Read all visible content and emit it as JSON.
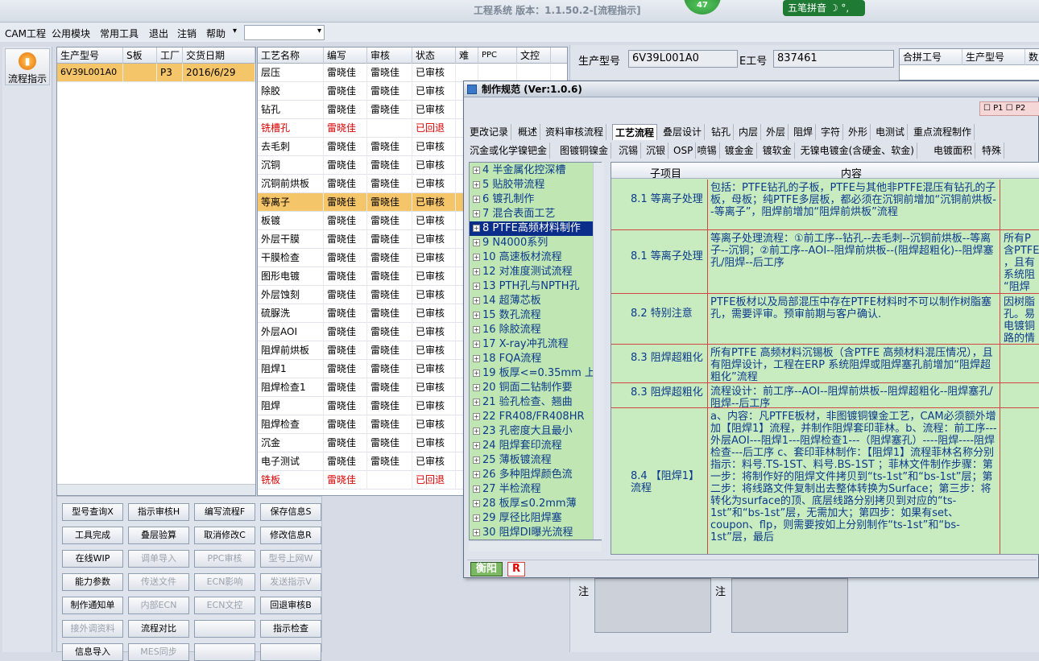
{
  "window": {
    "title": "工程系统 版本：1.1.50.2-[流程指示]",
    "badge": "47",
    "ime_label": "五笔拼音 ☽ °,"
  },
  "menu": {
    "items": [
      "CAM工程",
      "公用模块",
      "常用工具",
      "退出",
      "注销",
      "帮助"
    ],
    "combo_value": ""
  },
  "nav": {
    "label": "流程指示",
    "icon": "play-circle-icon"
  },
  "order_grid": {
    "headers": [
      "生产型号",
      "S板",
      "工厂",
      "交货日期"
    ],
    "rows": [
      [
        "6V39L001A0",
        "",
        "P3",
        "2016/6/29"
      ]
    ]
  },
  "process_grid": {
    "headers": [
      "工艺名称",
      "编写",
      "审核",
      "状态",
      "难",
      "PPC",
      "文控"
    ],
    "rows": [
      {
        "name": "层压",
        "writer": "雷晓佳",
        "reviewer": "雷晓佳",
        "status": "已审核",
        "red": false,
        "selected": false
      },
      {
        "name": "除胶",
        "writer": "雷晓佳",
        "reviewer": "雷晓佳",
        "status": "已审核",
        "red": false,
        "selected": false
      },
      {
        "name": "钻孔",
        "writer": "雷晓佳",
        "reviewer": "雷晓佳",
        "status": "已审核",
        "red": false,
        "selected": false
      },
      {
        "name": "铣槽孔",
        "writer": "雷晓佳",
        "reviewer": "",
        "status": "已回退",
        "red": true,
        "selected": false
      },
      {
        "name": "去毛刺",
        "writer": "雷晓佳",
        "reviewer": "雷晓佳",
        "status": "已审核",
        "red": false,
        "selected": false
      },
      {
        "name": "沉铜",
        "writer": "雷晓佳",
        "reviewer": "雷晓佳",
        "status": "已审核",
        "red": false,
        "selected": false
      },
      {
        "name": "沉铜前烘板",
        "writer": "雷晓佳",
        "reviewer": "雷晓佳",
        "status": "已审核",
        "red": false,
        "selected": false
      },
      {
        "name": "等离子",
        "writer": "雷晓佳",
        "reviewer": "雷晓佳",
        "status": "已审核",
        "red": false,
        "selected": true
      },
      {
        "name": "板镀",
        "writer": "雷晓佳",
        "reviewer": "雷晓佳",
        "status": "已审核",
        "red": false,
        "selected": false
      },
      {
        "name": "外层干膜",
        "writer": "雷晓佳",
        "reviewer": "雷晓佳",
        "status": "已审核",
        "red": false,
        "selected": false
      },
      {
        "name": "干膜检查",
        "writer": "雷晓佳",
        "reviewer": "雷晓佳",
        "status": "已审核",
        "red": false,
        "selected": false
      },
      {
        "name": "图形电镀",
        "writer": "雷晓佳",
        "reviewer": "雷晓佳",
        "status": "已审核",
        "red": false,
        "selected": false
      },
      {
        "name": "外层蚀刻",
        "writer": "雷晓佳",
        "reviewer": "雷晓佳",
        "status": "已审核",
        "red": false,
        "selected": false
      },
      {
        "name": "硫脲洗",
        "writer": "雷晓佳",
        "reviewer": "雷晓佳",
        "status": "已审核",
        "red": false,
        "selected": false
      },
      {
        "name": "外层AOI",
        "writer": "雷晓佳",
        "reviewer": "雷晓佳",
        "status": "已审核",
        "red": false,
        "selected": false
      },
      {
        "name": "阻焊前烘板",
        "writer": "雷晓佳",
        "reviewer": "雷晓佳",
        "status": "已审核",
        "red": false,
        "selected": false
      },
      {
        "name": "阻焊1",
        "writer": "雷晓佳",
        "reviewer": "雷晓佳",
        "status": "已审核",
        "red": false,
        "selected": false
      },
      {
        "name": "阻焊检查1",
        "writer": "雷晓佳",
        "reviewer": "雷晓佳",
        "status": "已审核",
        "red": false,
        "selected": false
      },
      {
        "name": "阻焊",
        "writer": "雷晓佳",
        "reviewer": "雷晓佳",
        "status": "已审核",
        "red": false,
        "selected": false
      },
      {
        "name": "阻焊检查",
        "writer": "雷晓佳",
        "reviewer": "雷晓佳",
        "status": "已审核",
        "red": false,
        "selected": false
      },
      {
        "name": "沉金",
        "writer": "雷晓佳",
        "reviewer": "雷晓佳",
        "status": "已审核",
        "red": false,
        "selected": false
      },
      {
        "name": "电子测试",
        "writer": "雷晓佳",
        "reviewer": "雷晓佳",
        "status": "已审核",
        "red": false,
        "selected": false
      },
      {
        "name": "铣板",
        "writer": "雷晓佳",
        "reviewer": "",
        "status": "已回退",
        "red": true,
        "selected": false
      }
    ]
  },
  "buttons": [
    {
      "label": "型号查询X",
      "enabled": true
    },
    {
      "label": "指示审核H",
      "enabled": true
    },
    {
      "label": "编写流程F",
      "enabled": true
    },
    {
      "label": "保存信息S",
      "enabled": true
    },
    {
      "label": "工具完成",
      "enabled": true
    },
    {
      "label": "叠层验算",
      "enabled": true
    },
    {
      "label": "取消修改C",
      "enabled": true
    },
    {
      "label": "修改信息R",
      "enabled": true
    },
    {
      "label": "在线WIP",
      "enabled": true
    },
    {
      "label": "调单导入",
      "enabled": false
    },
    {
      "label": "PPC审核",
      "enabled": false
    },
    {
      "label": "型号上网W",
      "enabled": false
    },
    {
      "label": "能力参数",
      "enabled": true
    },
    {
      "label": "传送文件",
      "enabled": false
    },
    {
      "label": "ECN影响",
      "enabled": false
    },
    {
      "label": "发送指示V",
      "enabled": false
    },
    {
      "label": "制作通知单",
      "enabled": true
    },
    {
      "label": "内部ECN",
      "enabled": false
    },
    {
      "label": "ECN文控",
      "enabled": false
    },
    {
      "label": "回退审核B",
      "enabled": true
    },
    {
      "label": "接外调资料",
      "enabled": false
    },
    {
      "label": "流程对比",
      "enabled": true
    },
    {
      "label": "",
      "enabled": true
    },
    {
      "label": "指示检查",
      "enabled": true
    },
    {
      "label": "信息导入",
      "enabled": true
    },
    {
      "label": "MES同步",
      "enabled": false
    },
    {
      "label": "",
      "enabled": true
    },
    {
      "label": "",
      "enabled": true
    }
  ],
  "right_panel": {
    "model_label": "生产型号",
    "model_value": "6V39L001A0",
    "e_label": "E工号",
    "e_value": "837461",
    "merge_headers": [
      "合拼工号",
      "生产型号",
      "数"
    ],
    "note_label": "注"
  },
  "dialog": {
    "title": "制作规范 (Ver:1.0.6)",
    "checks": [
      "P1",
      "P2"
    ],
    "tabs_row1": [
      "更改记录",
      "概述",
      "资料审核流程",
      "工艺流程",
      "叠层设计",
      "钻孔",
      "内层",
      "外层",
      "阻焊",
      "字符",
      "外形",
      "电测试",
      "重点流程制作"
    ],
    "active_tab": "工艺流程",
    "tabs_row2": [
      "沉金或化学镍钯金",
      "图镀铜镍金",
      "沉锡",
      "沉银",
      "OSP",
      "喷锡",
      "镀金金",
      "镀软金",
      "无镍电镀金(含硬金、软金)",
      "电镀面积",
      "特殊"
    ],
    "tree_items": [
      "4 半金属化控深槽",
      "5 贴胶带流程",
      "6 镀孔制作",
      "7 混合表面工艺",
      "8 PTFE高频材料制作",
      "9 N4000系列",
      "10 高速板材流程",
      "12 对准度测试流程",
      "13 PTH孔与NPTH孔",
      "14 超薄芯板",
      "15 数孔流程",
      "16 除胶流程",
      "17 X-ray冲孔流程",
      "18 FQA流程",
      "19 板厚<=0.35mm 上",
      "20 铜面二钻制作要",
      "21 验孔检查、翘曲",
      "22 FR408/FR408HR",
      "23 孔密度大且最小",
      "24 阻焊套印流程",
      "25 薄板镀流程",
      "26 多种阻焊颜色流",
      "27 半检流程",
      "28 板厚≤0.2mm薄",
      "29 厚径比阻焊塞",
      "30 阻焊DI曝光流程"
    ],
    "tree_selected": 4,
    "detail_headers": [
      "子项目",
      "内容"
    ],
    "detail_rows": [
      {
        "sub": "8.1 等离子处理",
        "content": "包括：PTFE钻孔的子板，PTFE与其他非PTFE混压有钻孔的子板，母板；纯PTFE多层板，都必须在沉铜前增加“沉铜前烘板--等离子”，阻焊前增加“阻焊前烘板”流程",
        "extra": ""
      },
      {
        "sub": "8.1 等离子处理",
        "content": "等离子处理流程：①前工序--钻孔--去毛刺--沉铜前烘板--等离子--沉铜；②前工序--AOI--阻焊前烘板--(阻焊超粗化)--阻焊塞孔/阻焊--后工序",
        "extra": "所有P\n含PTFE\n，且有\n系统阻\n“阻焊"
      },
      {
        "sub": "8.2 特别注意",
        "content": "PTFE板材以及局部混压中存在PTFE材料时不可以制作树脂塞孔，需要评审。预审前期与客户确认.",
        "extra": "因树脂\n孔。易\n电镀铜\n路的情"
      },
      {
        "sub": "8.3 阻焊超粗化",
        "content": "所有PTFE 高频材料沉锡板（含PTFE 高频材料混压情况），且有阻焊设计，工程在ERP 系统阻焊或阻焊塞孔前增加“阻焊超粗化”流程",
        "extra": ""
      },
      {
        "sub": "8.3 阻焊超粗化",
        "content": "流程设计：前工序--AOI--阻焊前烘板--阻焊超粗化--阻焊塞孔/阻焊--后工序",
        "extra": ""
      },
      {
        "sub": "8.4 【阻焊1】流程",
        "content": "a、内容：凡PTFE板材，非图镀铜镍金工艺，CAM必须额外增加【阻焊1】流程，并制作阻焊套印菲林。b、流程：前工序---外层AOI---阻焊1---阻焊检查1---（阻焊塞孔）----阻焊----阻焊检查---后工序 c、套印菲林制作：【阻焊1】流程菲林名称分别指示：料号.TS-1ST、料号.BS-1ST ；菲林文件制作步骤：第一步：将制作好的阻焊文件拷贝到“ts-1st”和“bs-1st”层；第二步：将线路文件复制出去整体转换为Surface；第三步：将转化为surface的顶、底层线路分别拷贝到对应的“ts-1st”和“bs-1st”层，无需加大；第四步：如果有set、coupon、flp，则需要按如上分别制作“ts-1st”和“bs-1st”层，最后",
        "extra": ""
      }
    ],
    "status_left": "衡阳",
    "status_right": "R"
  }
}
